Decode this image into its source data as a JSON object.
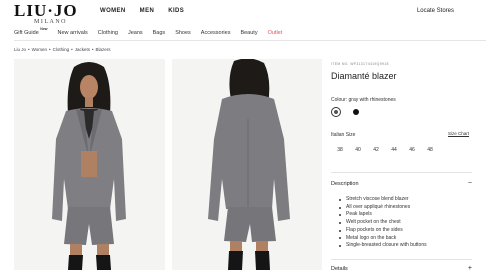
{
  "brand": {
    "logo_main": "LIU·JO",
    "logo_sub": "MILANO"
  },
  "top_nav": [
    "WOMEN",
    "MEN",
    "KIDS"
  ],
  "locate_stores": "Locate Stores",
  "categories": [
    {
      "label": "Gift Guide",
      "badge": "New"
    },
    {
      "label": "New arrivals"
    },
    {
      "label": "Clothing"
    },
    {
      "label": "Jeans"
    },
    {
      "label": "Bags"
    },
    {
      "label": "Shoes"
    },
    {
      "label": "Accessories"
    },
    {
      "label": "Beauty"
    },
    {
      "label": "Outlet",
      "highlight": "#e2545c"
    }
  ],
  "breadcrumb": [
    "Liu Jo",
    "Women",
    "Clothing",
    "Jackets",
    "Blazers"
  ],
  "breadcrumb_sep": "•",
  "product": {
    "item_no": "ITEM NO. WF3131T4419Q9918",
    "title": "Diamanté blazer",
    "colour_text": "Colour: gray with rhinestones",
    "swatch_colors": [
      "#555555",
      "#111111"
    ],
    "size_label": "Italian Size",
    "size_chart": "Size Chart",
    "sizes": [
      "38",
      "40",
      "42",
      "44",
      "46",
      "48"
    ]
  },
  "description": {
    "heading": "Description",
    "toggle": "−",
    "items": [
      "Stretch viscose blend blazer",
      "All over appliqué rhinestones",
      "Peak lapels",
      "Welt pocket on the chest",
      "Flap pockets on the sides",
      "Metal logo on the back",
      "Single-breasted closure with buttons"
    ]
  },
  "details": {
    "heading": "Details",
    "toggle": "+"
  }
}
